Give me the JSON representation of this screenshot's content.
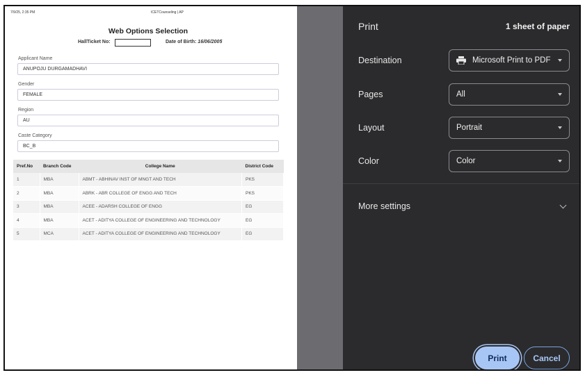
{
  "preview": {
    "header_date": "7/9/25, 2:35 PM",
    "header_site": "ICETCounseling | AP",
    "title": "Web Options Selection",
    "hallticket_label": "HallTicket No:",
    "dob_label": "Date of Birth:",
    "dob_value": "16/06/2005",
    "fields": [
      {
        "label": "Applicant Name",
        "value": "ANUPOJU DURGAMADHAVI"
      },
      {
        "label": "Gender",
        "value": "FEMALE"
      },
      {
        "label": "Region",
        "value": "AU"
      },
      {
        "label": "Caste Category",
        "value": "BC_B"
      }
    ],
    "table": {
      "headers": [
        "Pref.No",
        "Branch Code",
        "College Name",
        "District Code"
      ],
      "rows": [
        [
          "1",
          "MBA",
          "ABMT - ABHINAV INST OF MNGT AND TECH",
          "PKS"
        ],
        [
          "2",
          "MBA",
          "ABRK - ABR COLLEGE OF ENGG AND TECH",
          "PKS"
        ],
        [
          "3",
          "MBA",
          "ACEE - ADARSH COLLEGE OF ENGG",
          "EG"
        ],
        [
          "4",
          "MBA",
          "ACET - ADITYA COLLEGE OF ENGINEERING AND TECHNOLOGY",
          "EG"
        ],
        [
          "5",
          "MCA",
          "ACET - ADITYA COLLEGE OF ENGINEERING AND TECHNOLOGY",
          "EG"
        ]
      ]
    }
  },
  "print_panel": {
    "title": "Print",
    "sheets": "1 sheet of paper",
    "destination_label": "Destination",
    "destination_value": "Microsoft Print to PDF",
    "destination_icon": "printer-icon",
    "pages_label": "Pages",
    "pages_value": "All",
    "layout_label": "Layout",
    "layout_value": "Portrait",
    "color_label": "Color",
    "color_value": "Color",
    "more_settings_label": "More settings",
    "print_button": "Print",
    "cancel_button": "Cancel"
  },
  "colors": {
    "panel_bg": "#2b2b2d",
    "primary_button": "#a8c6f5",
    "preview_gutter": "#6b6b70"
  }
}
